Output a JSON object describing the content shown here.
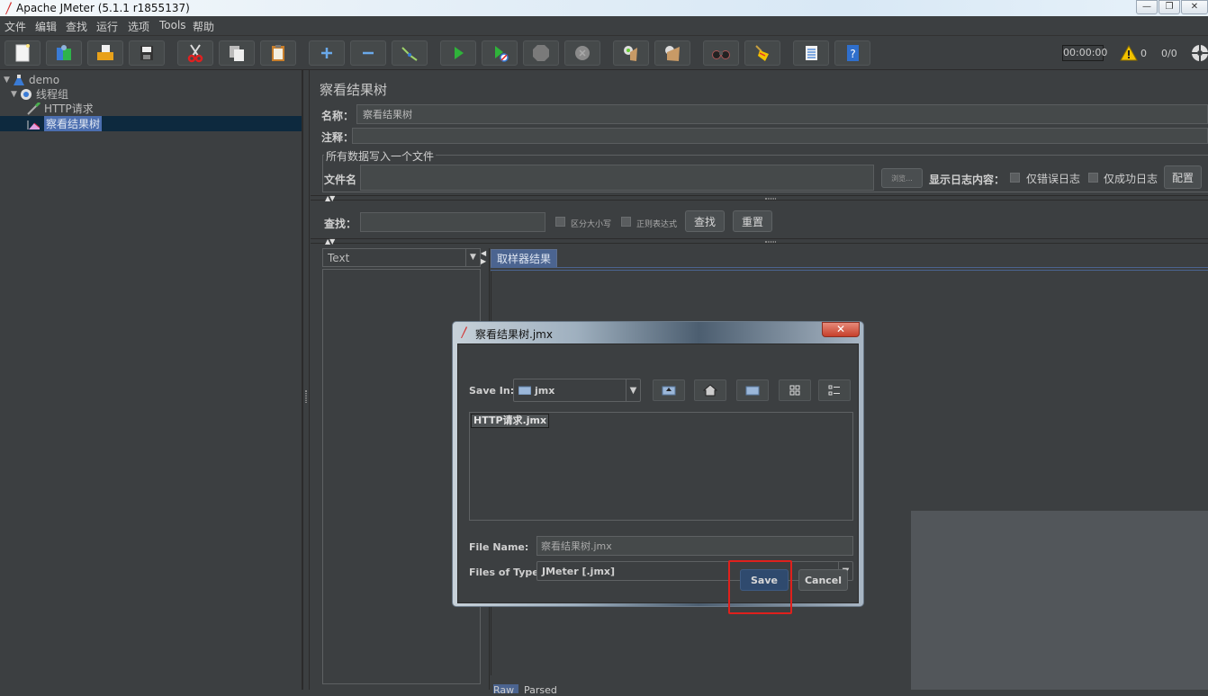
{
  "window": {
    "title": "Apache JMeter (5.1.1 r1855137)",
    "controls": {
      "minimize": "—",
      "restore": "❐",
      "close": "✕"
    }
  },
  "menu": [
    "文件",
    "编辑",
    "查找",
    "运行",
    "选项",
    "Tools",
    "帮助"
  ],
  "toolbar": {
    "buttons": [
      {
        "name": "new",
        "icon": "new-file-icon"
      },
      {
        "name": "templates",
        "icon": "templates-icon"
      },
      {
        "name": "open",
        "icon": "open-folder-icon"
      },
      {
        "name": "save",
        "icon": "save-icon"
      },
      {
        "name": "cut",
        "icon": "scissors-icon"
      },
      {
        "name": "copy",
        "icon": "copy-icon"
      },
      {
        "name": "paste",
        "icon": "paste-icon"
      },
      {
        "name": "expand",
        "icon": "plus-icon"
      },
      {
        "name": "collapse",
        "icon": "minus-icon"
      },
      {
        "name": "toggle",
        "icon": "toggle-icon"
      },
      {
        "name": "start",
        "icon": "play-icon"
      },
      {
        "name": "start-no-pause",
        "icon": "play-no-timers-icon"
      },
      {
        "name": "stop",
        "icon": "stop-icon"
      },
      {
        "name": "shutdown",
        "icon": "shutdown-icon"
      },
      {
        "name": "clear",
        "icon": "clear-icon"
      },
      {
        "name": "clear-all",
        "icon": "clear-all-icon"
      },
      {
        "name": "search",
        "icon": "binoculars-icon"
      },
      {
        "name": "reset-search",
        "icon": "broom-icon"
      },
      {
        "name": "function-helper",
        "icon": "function-list-icon"
      },
      {
        "name": "help",
        "icon": "help-icon"
      }
    ],
    "timer": "00:00:00",
    "warning_count": "0",
    "thread_count": "0/0"
  },
  "tree": {
    "items": [
      {
        "label": "demo",
        "icon": "testplan-flask-icon",
        "level": 0
      },
      {
        "label": "线程组",
        "icon": "gear-icon",
        "level": 1
      },
      {
        "label": "HTTP请求",
        "icon": "pipette-icon",
        "level": 2
      },
      {
        "label": "察看结果树",
        "icon": "chart-icon",
        "level": 2,
        "selected": true
      }
    ]
  },
  "panel": {
    "title": "察看结果树",
    "name_label": "名称：",
    "name_value": "察看结果树",
    "comment_label": "注释：",
    "comment_value": "",
    "file_group_title": "所有数据写入一个文件",
    "filename_label": "文件名",
    "filename_value": "",
    "browse_label": "浏览...",
    "log_label": "显示日志内容：",
    "errors_only_label": "仅错误日志",
    "success_only_label": "仅成功日志",
    "configure_label": "配置",
    "search_label": "查找：",
    "search_value": "",
    "case_sensitive_label": "区分大小写",
    "regex_label": "正则表达式",
    "search_button": "查找",
    "reset_button": "重置",
    "renderer_value": "Text",
    "result_tab": "取样器结果",
    "bottom_tabs": [
      "Raw",
      "Parsed"
    ]
  },
  "dialog": {
    "title": "察看结果树.jmx",
    "save_in_label": "Save In:",
    "save_in_value": "jmx",
    "files": [
      "HTTP请求.jmx"
    ],
    "file_name_label": "File Name:",
    "file_name_value": "察看结果树.jmx",
    "file_type_label": "Files of Type:",
    "file_type_value": "JMeter [.jmx]",
    "save_button": "Save",
    "cancel_button": "Cancel",
    "icon_buttons": [
      "up-folder-icon",
      "home-icon",
      "new-folder-icon",
      "list-view-icon",
      "details-view-icon"
    ]
  },
  "colors": {
    "background": "#3c3f41",
    "selection": "#4b6eaf",
    "highlight_red": "#e0201c",
    "save_button": "#2f4a6e"
  }
}
